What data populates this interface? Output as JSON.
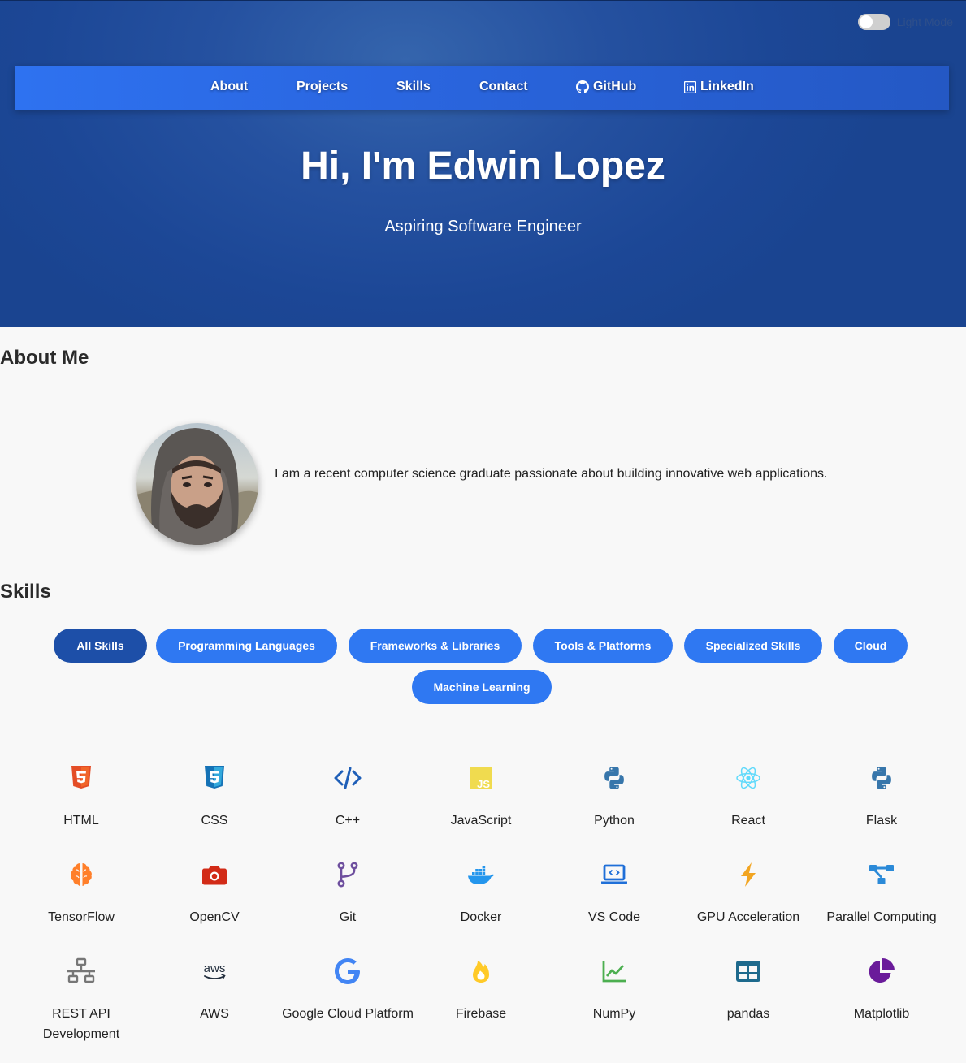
{
  "theme_toggle": {
    "label": "Light Mode"
  },
  "nav": {
    "items": [
      {
        "label": "About"
      },
      {
        "label": "Projects"
      },
      {
        "label": "Skills"
      },
      {
        "label": "Contact"
      },
      {
        "label": "GitHub",
        "icon": "github-icon"
      },
      {
        "label": "LinkedIn",
        "icon": "linkedin-icon"
      }
    ]
  },
  "hero": {
    "title": "Hi, I'm Edwin Lopez",
    "subtitle": "Aspiring Software Engineer"
  },
  "about": {
    "heading": "About Me",
    "text": "I am a recent computer science graduate passionate about building innovative web applications."
  },
  "skills": {
    "heading": "Skills",
    "filters": [
      {
        "label": "All Skills",
        "active": true
      },
      {
        "label": "Programming Languages",
        "active": false
      },
      {
        "label": "Frameworks & Libraries",
        "active": false
      },
      {
        "label": "Tools & Platforms",
        "active": false
      },
      {
        "label": "Specialized Skills",
        "active": false
      },
      {
        "label": "Cloud",
        "active": false
      },
      {
        "label": "Machine Learning",
        "active": false
      }
    ],
    "items": [
      {
        "name": "HTML",
        "icon": "html5-icon",
        "color": "#e44d26"
      },
      {
        "name": "CSS",
        "icon": "css3-icon",
        "color": "#2965f1"
      },
      {
        "name": "C++",
        "icon": "code-icon",
        "color": "#1f5fb8"
      },
      {
        "name": "JavaScript",
        "icon": "javascript-icon",
        "color": "#f0db4f"
      },
      {
        "name": "Python",
        "icon": "python-icon",
        "color": "#3776ab"
      },
      {
        "name": "React",
        "icon": "react-icon",
        "color": "#61dafb"
      },
      {
        "name": "Flask",
        "icon": "python-icon",
        "color": "#3776ab"
      },
      {
        "name": "TensorFlow",
        "icon": "brain-icon",
        "color": "#ff7f2a"
      },
      {
        "name": "OpenCV",
        "icon": "camera-icon",
        "color": "#d22b17"
      },
      {
        "name": "Git",
        "icon": "branch-icon",
        "color": "#6e4f9e"
      },
      {
        "name": "Docker",
        "icon": "docker-icon",
        "color": "#2496ed"
      },
      {
        "name": "VS Code",
        "icon": "laptop-code-icon",
        "color": "#1f6fd8"
      },
      {
        "name": "GPU Acceleration",
        "icon": "bolt-icon",
        "color": "#f2a521"
      },
      {
        "name": "Parallel Computing",
        "icon": "network-icon",
        "color": "#2b8ad8"
      },
      {
        "name": "REST API Development",
        "icon": "sitemap-icon",
        "color": "#777777"
      },
      {
        "name": "AWS",
        "icon": "aws-icon",
        "color": "#232f3e"
      },
      {
        "name": "Google Cloud Platform",
        "icon": "google-icon",
        "color": "#4285f4"
      },
      {
        "name": "Firebase",
        "icon": "fire-icon",
        "color": "#ffca28"
      },
      {
        "name": "NumPy",
        "icon": "chart-line-icon",
        "color": "#4caf50"
      },
      {
        "name": "pandas",
        "icon": "table-icon",
        "color": "#150458"
      },
      {
        "name": "Matplotlib",
        "icon": "chart-pie-icon",
        "color": "#6a1b9a"
      }
    ]
  }
}
